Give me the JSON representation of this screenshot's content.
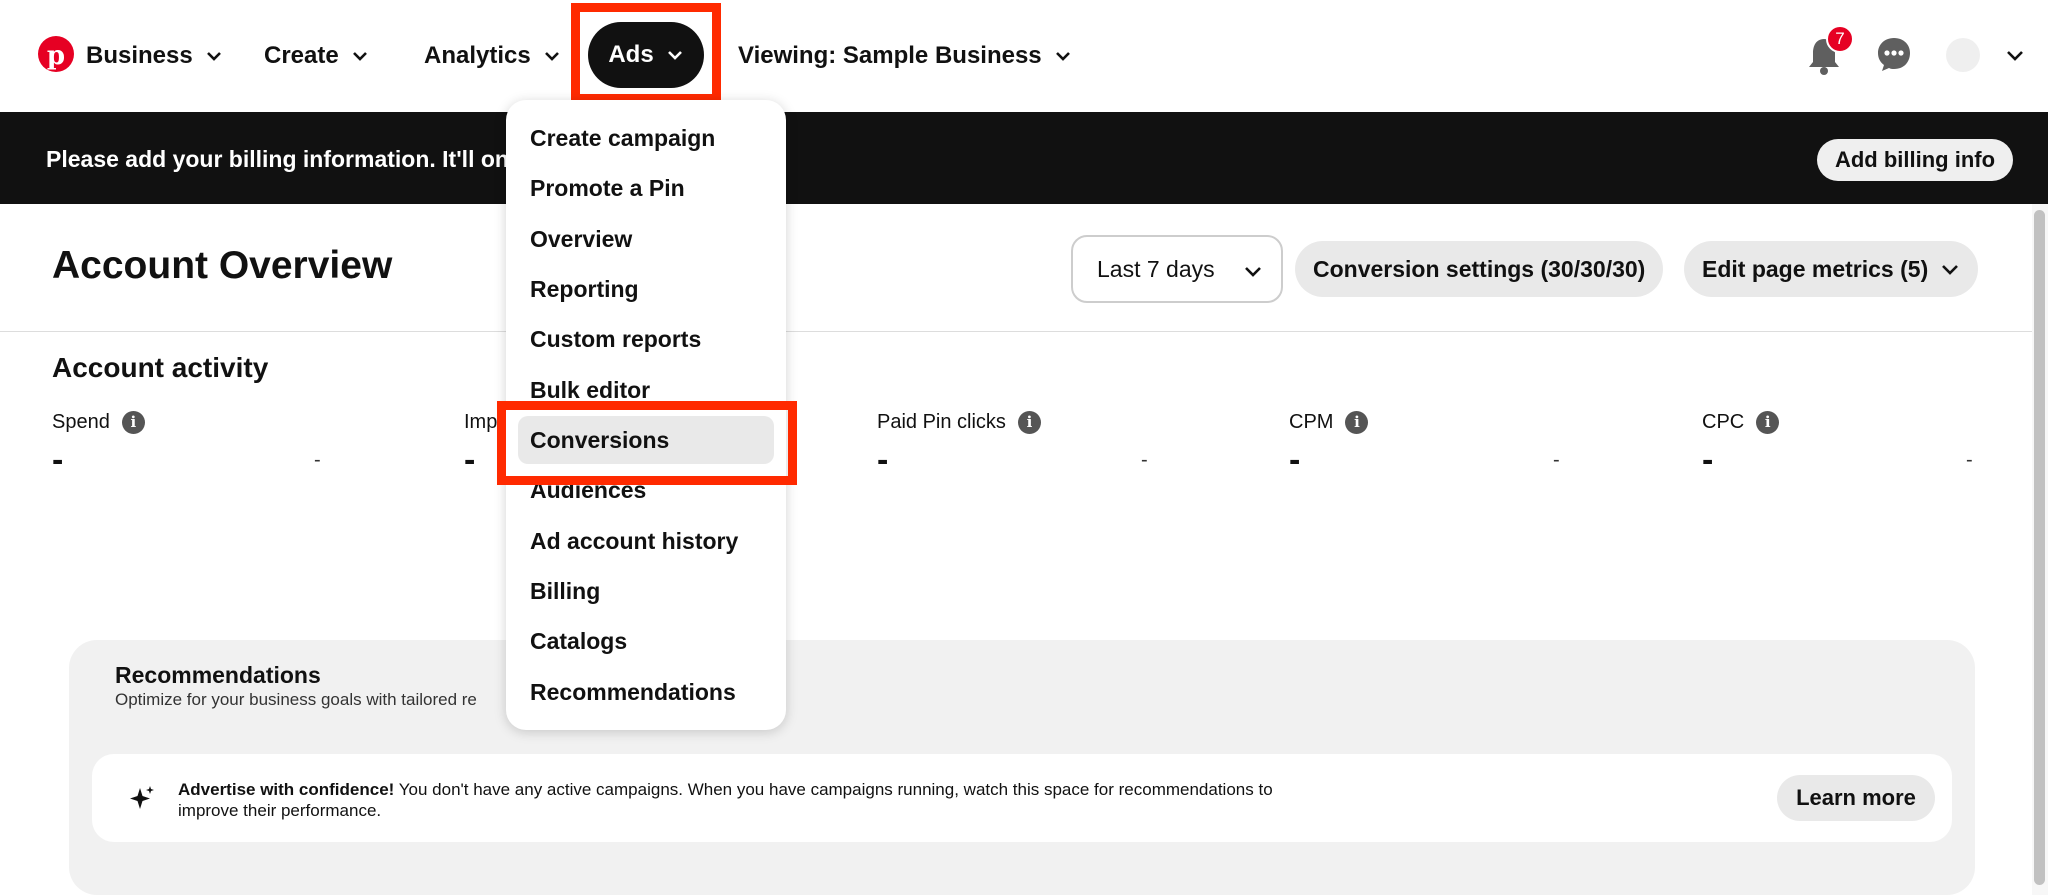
{
  "nav": {
    "business": "Business",
    "create": "Create",
    "analytics": "Analytics",
    "ads": "Ads",
    "viewing": "Viewing: Sample Business",
    "notification_count": "7"
  },
  "banner": {
    "text": "Please add your billing information. It'll onl",
    "button": "Add billing info"
  },
  "header": {
    "title": "Account Overview",
    "date_range": "Last 7 days",
    "conversion_settings": "Conversion settings (30/30/30)",
    "edit_metrics": "Edit page metrics (5)"
  },
  "activity": {
    "title": "Account activity",
    "metrics": [
      {
        "label": "Spend",
        "value": "-",
        "delta": "-"
      },
      {
        "label": "Imp",
        "value": "-",
        "delta": ""
      },
      {
        "label": "Paid Pin clicks",
        "value": "-",
        "delta": "-"
      },
      {
        "label": "CPM",
        "value": "-",
        "delta": "-"
      },
      {
        "label": "CPC",
        "value": "-",
        "delta": "-"
      }
    ]
  },
  "recommendations": {
    "title": "Recommendations",
    "subtitle": "Optimize for your business goals with tailored re",
    "message_bold": "Advertise with confidence!",
    "message": " You don't have any active campaigns. When you have campaigns running, watch this space for recommendations to improve their performance.",
    "button": "Learn more"
  },
  "menu": {
    "items": [
      "Create campaign",
      "Promote a Pin",
      "Overview",
      "Reporting",
      "Custom reports",
      "Bulk editor",
      "Conversions",
      "Audiences",
      "Ad account history",
      "Billing",
      "Catalogs",
      "Recommendations"
    ],
    "selected": "Conversions"
  },
  "colors": {
    "brand": "#e60023",
    "highlight_box": "#ff2a00",
    "banner_bg": "#111111"
  }
}
